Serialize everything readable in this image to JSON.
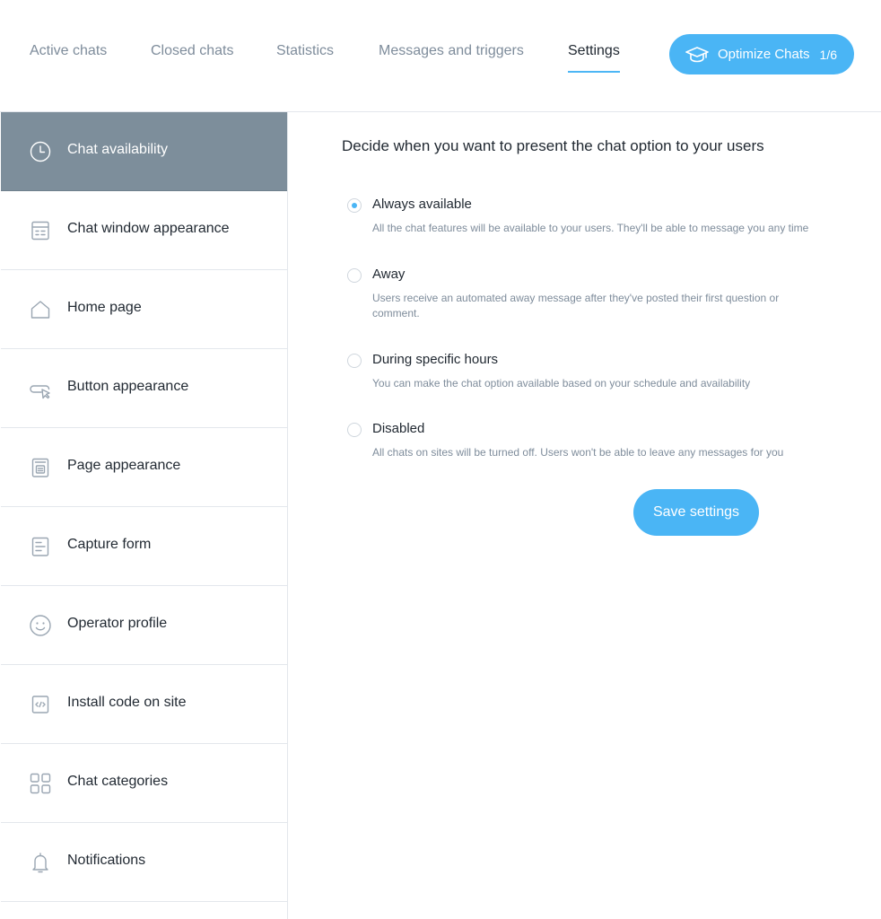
{
  "nav": {
    "tabs": [
      {
        "label": "Active chats"
      },
      {
        "label": "Closed chats"
      },
      {
        "label": "Statistics"
      },
      {
        "label": "Messages and triggers"
      },
      {
        "label": "Settings"
      }
    ],
    "active_tab": "Settings",
    "optimize": {
      "label": "Optimize Chats",
      "counter": "1/6",
      "icon": "graduation-cap-icon"
    }
  },
  "sidebar": {
    "active": "Chat availability",
    "items": [
      {
        "label": "Chat availability",
        "icon": "clock-icon"
      },
      {
        "label": "Chat window appearance",
        "icon": "chat-window-icon"
      },
      {
        "label": "Home page",
        "icon": "home-icon"
      },
      {
        "label": "Button appearance",
        "icon": "button-pointer-icon"
      },
      {
        "label": "Page appearance",
        "icon": "page-icon"
      },
      {
        "label": "Capture form",
        "icon": "form-icon"
      },
      {
        "label": "Operator profile",
        "icon": "smiley-icon"
      },
      {
        "label": "Install code on site",
        "icon": "code-icon"
      },
      {
        "label": "Chat categories",
        "icon": "grid-icon"
      },
      {
        "label": "Notifications",
        "icon": "bell-icon"
      }
    ]
  },
  "main": {
    "heading": "Decide when you want to present the chat option to your users",
    "selected_option": "Always available",
    "options": [
      {
        "title": "Always available",
        "description": "All the chat features will be available to your users. They'll be able to message you any time"
      },
      {
        "title": "Away",
        "description": "Users receive an automated away message after they've posted their first question or comment."
      },
      {
        "title": "During specific hours",
        "description": "You can make the chat option available based on your schedule and availability"
      },
      {
        "title": "Disabled",
        "description": "All chats on sites will be turned off. Users won't be able to leave any messages for you"
      }
    ],
    "save_label": "Save settings"
  },
  "colors": {
    "accent": "#4ab5f5",
    "sidebar_active": "#7d8e9b",
    "muted_text": "#7e8c9b"
  }
}
